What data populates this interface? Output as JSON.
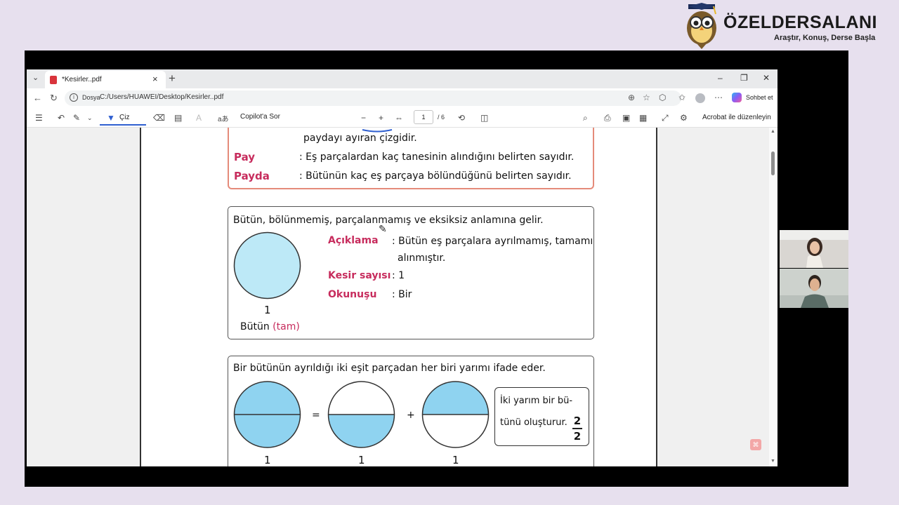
{
  "brand": {
    "name": "ÖZELDERSALANI",
    "tagline": "Araştır, Konuş, Derse Başla"
  },
  "browser": {
    "tab_title": "*Kesirler..pdf",
    "address_label": "Dosya",
    "address_url": "C:/Users/HUAWEI/Desktop/Kesirler..pdf",
    "chat_button": "Sohbet et"
  },
  "toolbar": {
    "draw_label": "Çiz",
    "copilot_label": "Copilot'a Sor",
    "page_current": "1",
    "page_total": "/ 6",
    "acrobat_label": "Acrobat ile düzenleyin"
  },
  "pdf": {
    "box1": {
      "intro_line": "paydayı ayıran çizgidir.",
      "rows": [
        {
          "term": "Pay",
          "text": ": Eş parçalardan kaç tanesinin alındığını belirten sayıdır."
        },
        {
          "term": "Payda",
          "text": ": Bütünün kaç eş parçaya bölündüğünü belirten sayıdır."
        }
      ]
    },
    "box2": {
      "heading": "Bütün, bölünmemiş, parçalanmamış ve eksiksiz anlamına gelir.",
      "circle_number": "1",
      "caption_prefix": "Bütün",
      "caption_suffix": "(tam)",
      "explanation_key": "Açıklama",
      "explanation_text_1": ": Bütün eş parçalara ayrılmamış, tamamı",
      "explanation_text_2": "alınmıştır.",
      "count_key": "Kesir sayısı",
      "count_value": ": 1",
      "reading_key": "Okunuşu",
      "reading_value": ": Bir"
    },
    "box3": {
      "heading": "Bir bütünün ayrıldığı iki eşit parçadan her biri yarımı ifade eder.",
      "equals": "=",
      "plus": "+",
      "circle_labels": [
        "1",
        "1",
        "1"
      ],
      "note_line_1": "İki yarım bir bü-",
      "note_line_2": "tünü oluşturur.",
      "fraction_numerator": "2",
      "fraction_denominator": "2"
    }
  },
  "colors": {
    "term": "#c72c5d",
    "circle_fill": "#bde9f7",
    "circle_half_fill": "#8fd3f0",
    "accent": "#2f5fd0"
  }
}
